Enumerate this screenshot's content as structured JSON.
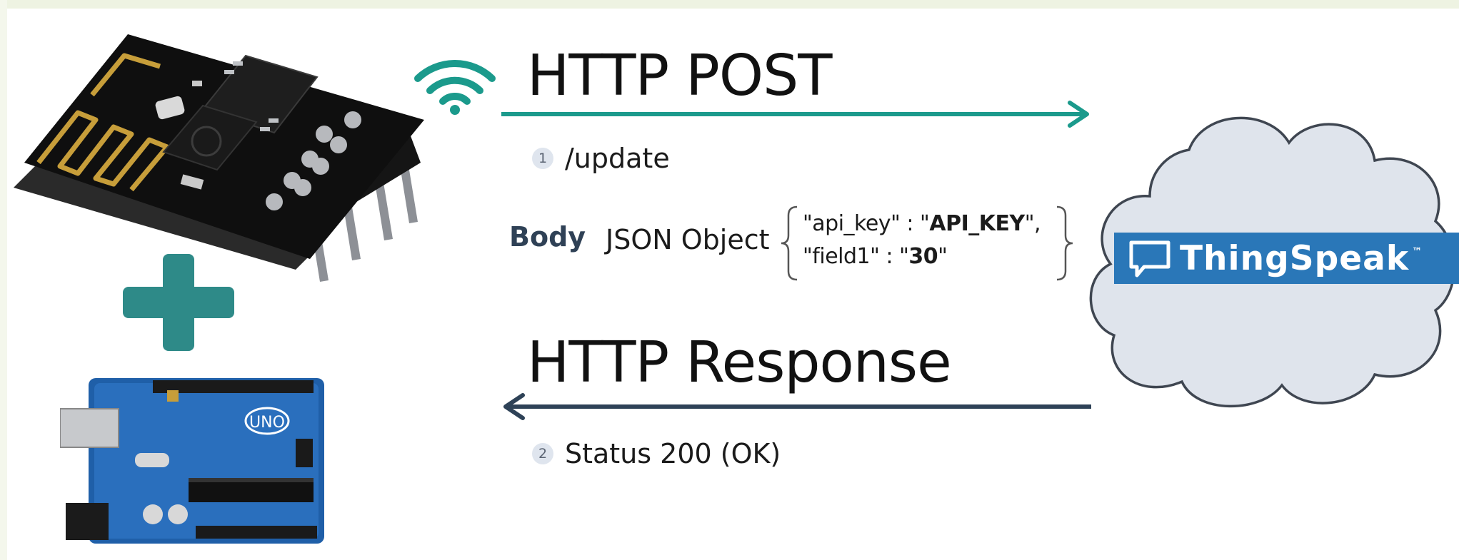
{
  "request": {
    "title": "HTTP POST",
    "step_number": "1",
    "endpoint": "/update",
    "body_label": "Body",
    "body_type": "JSON Object",
    "json_lines": [
      {
        "key": "\"api_key\" : \"",
        "value": "API_KEY",
        "end": "\","
      },
      {
        "key": "\"field1\" : \"",
        "value": "30",
        "end": "\""
      }
    ]
  },
  "response": {
    "title": "HTTP Response",
    "step_number": "2",
    "status": "Status 200 (OK)"
  },
  "server": {
    "brand": "ThingSpeak",
    "trademark": "™"
  },
  "devices": {
    "wifi_module_label": "UNO"
  },
  "colors": {
    "teal_arrow": "#1b9a8c",
    "dark_arrow": "#2e4257",
    "plus_sign": "#2e8a88",
    "brand_blue": "#2a77b8",
    "cloud_fill": "#dfe4ec",
    "cloud_stroke": "#3f4651"
  }
}
